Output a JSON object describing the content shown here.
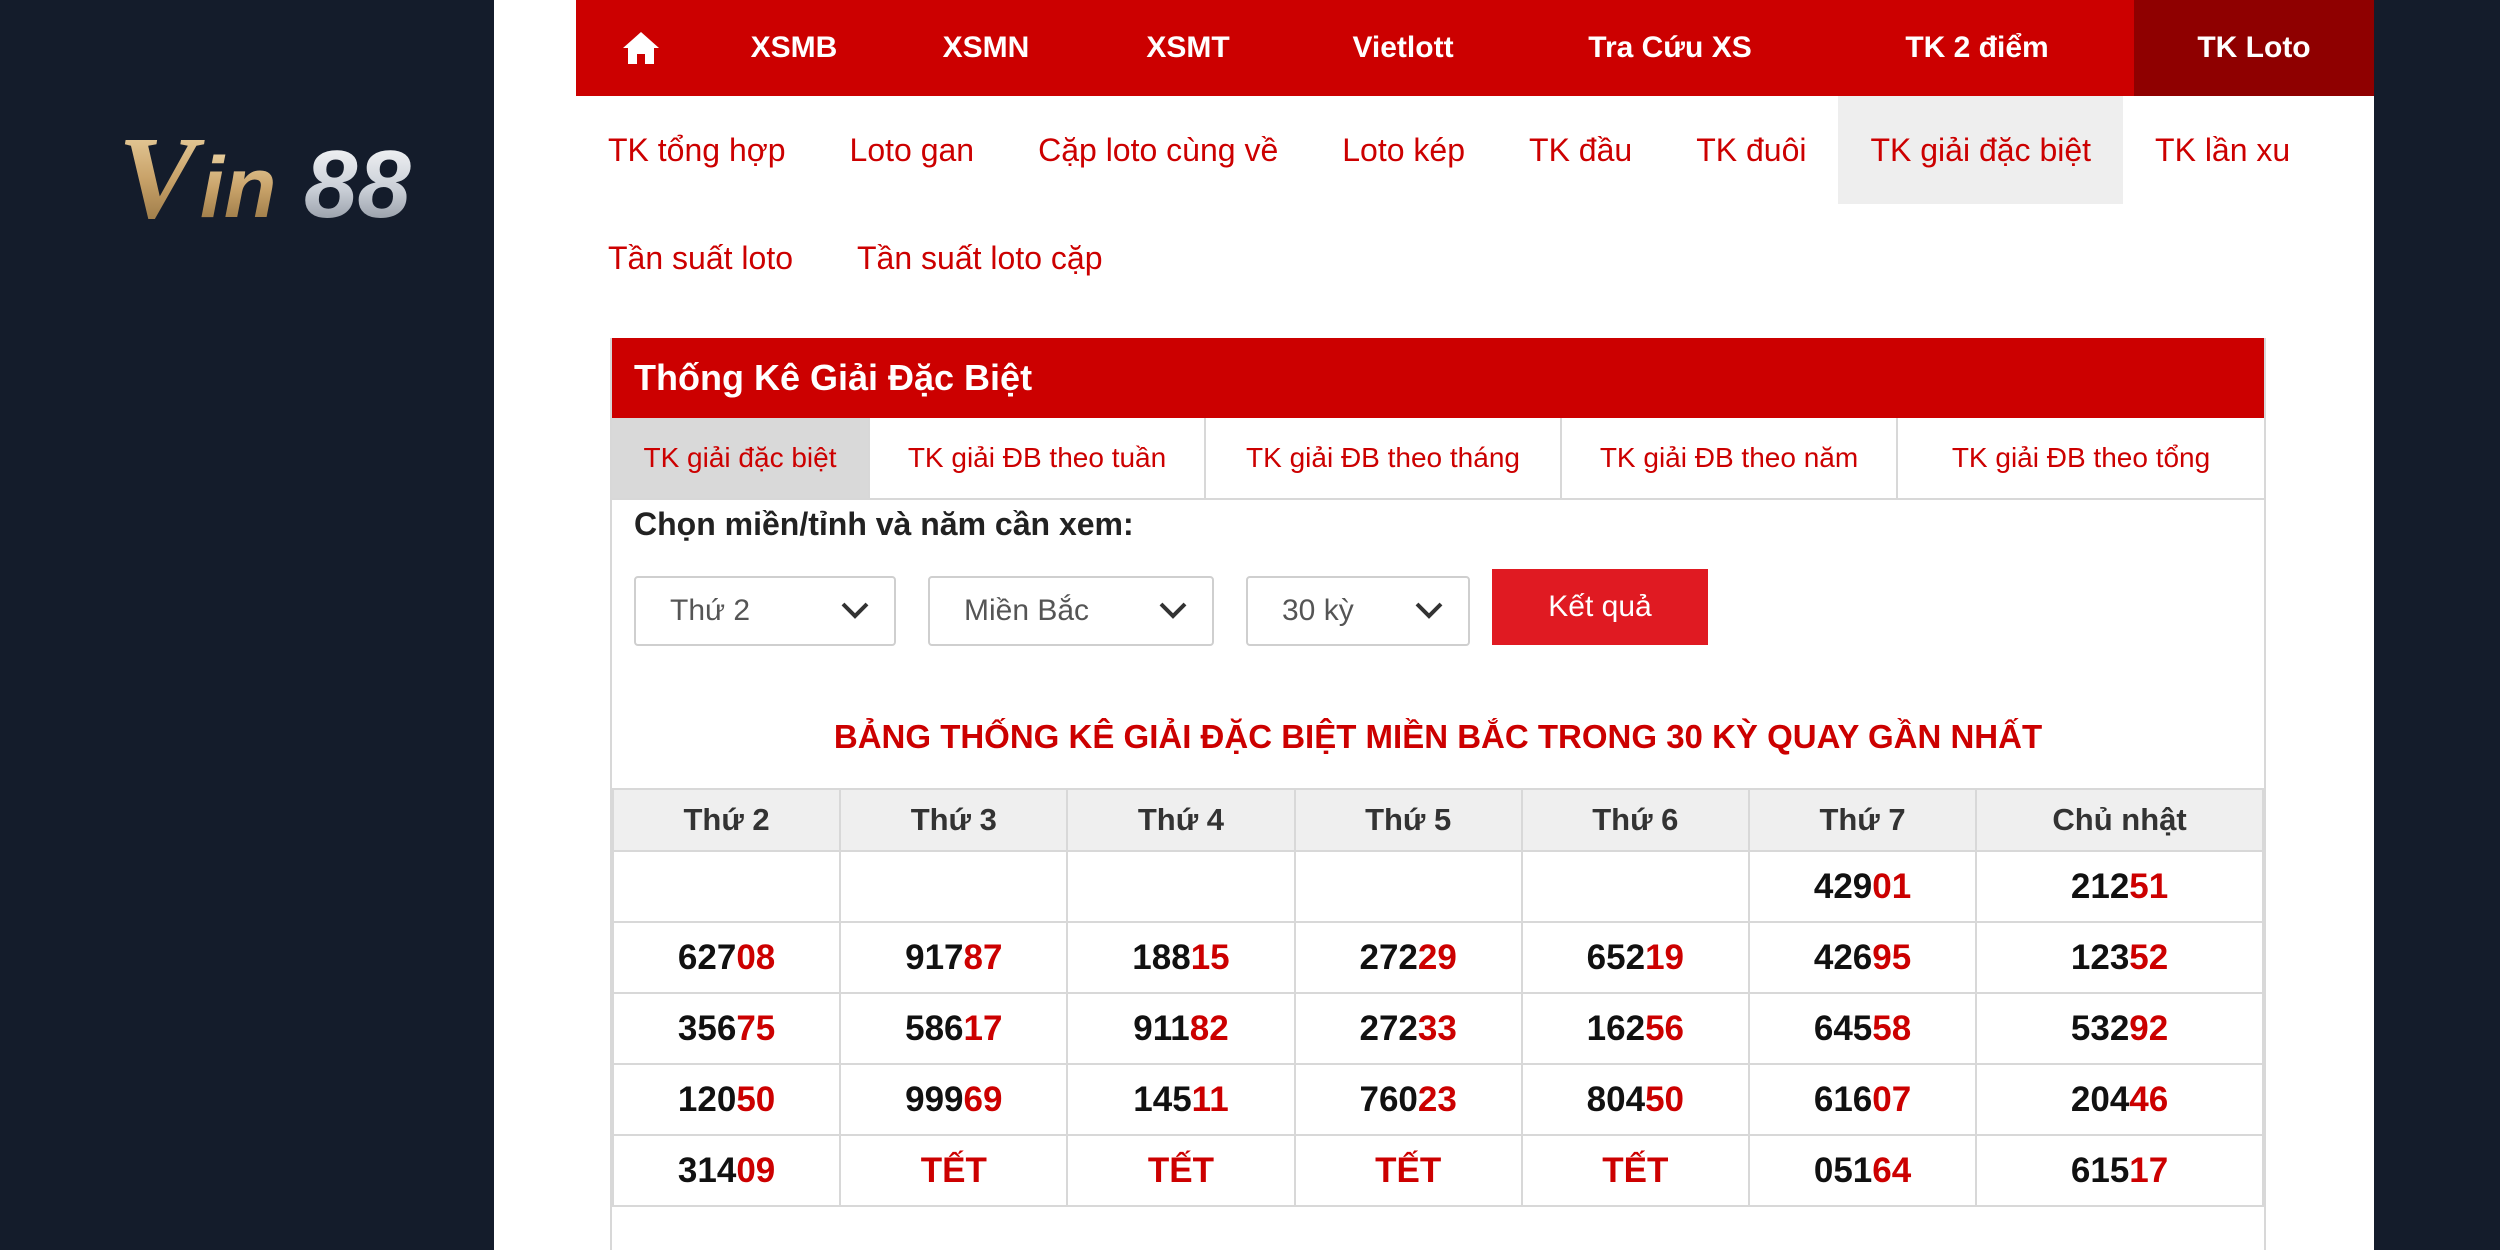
{
  "logo": {
    "text": "Vin88",
    "colors": {
      "vin": "#c9a36a",
      "num": "#c9ced6"
    }
  },
  "nav": {
    "home_icon": "home-icon",
    "items": [
      {
        "label": "XSMB",
        "active": false
      },
      {
        "label": "XSMN",
        "active": false
      },
      {
        "label": "XSMT",
        "active": false
      },
      {
        "label": "Vietlott",
        "active": false
      },
      {
        "label": "Tra Cứu XS",
        "active": false
      },
      {
        "label": "TK 2 điểm",
        "active": false
      },
      {
        "label": "TK Loto",
        "active": true
      }
    ]
  },
  "subnav": {
    "row1": [
      "TK tổng hợp",
      "Loto gan",
      "Cặp loto cùng về",
      "Loto kép",
      "TK đầu",
      "TK đuôi",
      "TK giải đặc biệt",
      "TK lần xu"
    ],
    "row1_active_index": 6,
    "row2": [
      "Tần suất loto",
      "Tần suất loto cặp"
    ]
  },
  "box": {
    "title": "Thống Kê Giải Đặc Biệt",
    "tabs": [
      "TK giải đặc biệt",
      "TK giải ĐB theo tuần",
      "TK giải ĐB theo tháng",
      "TK giải ĐB theo năm",
      "TK giải ĐB theo tổng"
    ],
    "active_tab": 0,
    "filter_label": "Chọn miền/tỉnh và năm cần xem:",
    "selects": {
      "day": "Thứ 2",
      "region": "Miền Bắc",
      "period": "30 kỳ"
    },
    "submit_label": "Kết quả",
    "table_title": "BẢNG THỐNG KÊ GIẢI ĐẶC BIỆT MIỀN BẮC TRONG 30 KỲ QUAY GẦN NHẤT",
    "table": {
      "headers": [
        "Thứ 2",
        "Thứ 3",
        "Thứ 4",
        "Thứ 5",
        "Thứ 6",
        "Thứ 7",
        "Chủ nhật"
      ],
      "rows": [
        [
          [
            "",
            ""
          ],
          [
            "",
            ""
          ],
          [
            "",
            ""
          ],
          [
            "",
            ""
          ],
          [
            "",
            ""
          ],
          [
            "429",
            "01"
          ],
          [
            "212",
            "51"
          ]
        ],
        [
          [
            "627",
            "08"
          ],
          [
            "917",
            "87"
          ],
          [
            "188",
            "15"
          ],
          [
            "272",
            "29"
          ],
          [
            "652",
            "19"
          ],
          [
            "426",
            "95"
          ],
          [
            "123",
            "52"
          ]
        ],
        [
          [
            "356",
            "75"
          ],
          [
            "586",
            "17"
          ],
          [
            "911",
            "82"
          ],
          [
            "272",
            "33"
          ],
          [
            "162",
            "56"
          ],
          [
            "645",
            "58"
          ],
          [
            "532",
            "92"
          ]
        ],
        [
          [
            "120",
            "50"
          ],
          [
            "999",
            "69"
          ],
          [
            "145",
            "11"
          ],
          [
            "760",
            "23"
          ],
          [
            "804",
            "50"
          ],
          [
            "616",
            "07"
          ],
          [
            "204",
            "46"
          ]
        ],
        [
          [
            "314",
            "09"
          ],
          [
            "",
            "TẾT"
          ],
          [
            "",
            "TẾT"
          ],
          [
            "",
            "TẾT"
          ],
          [
            "",
            "TẾT"
          ],
          [
            "051",
            "64"
          ],
          [
            "615",
            "17"
          ]
        ]
      ]
    }
  },
  "colors": {
    "primary": "#cc0000",
    "dark_active": "#8f0000",
    "button": "#e01a22",
    "background": "#141c2b"
  }
}
